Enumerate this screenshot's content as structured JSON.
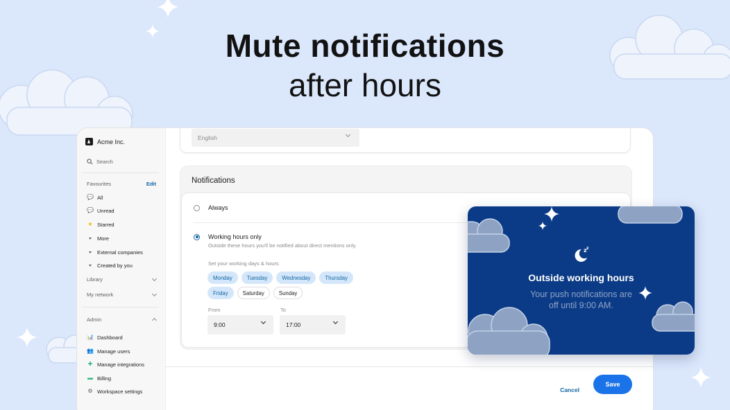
{
  "hero": {
    "line1": "Mute notifications",
    "line2": "after hours"
  },
  "sidebar": {
    "workspace": "Acme Inc.",
    "search": "Search",
    "favourites": {
      "label": "Favourites",
      "edit": "Edit"
    },
    "items": [
      {
        "label": "All",
        "icon": "speech-bubble-icon"
      },
      {
        "label": "Unread",
        "icon": "speech-bubble-icon"
      },
      {
        "label": "Starred",
        "icon": "star-icon"
      },
      {
        "label": "More",
        "icon": "caret-down-icon"
      },
      {
        "label": "External companies",
        "icon": "caret-down-icon"
      },
      {
        "label": "Created by you",
        "icon": "caret-down-icon"
      }
    ],
    "library": "Library",
    "my_network": "My network",
    "admin": "Admin",
    "admin_items": [
      {
        "label": "Dashboard",
        "icon": "bar-chart-icon"
      },
      {
        "label": "Manage users",
        "icon": "users-icon"
      },
      {
        "label": "Manage integrations",
        "icon": "puzzle-icon"
      },
      {
        "label": "Billing",
        "icon": "money-icon"
      },
      {
        "label": "Workspace settings",
        "icon": "gear-icon"
      }
    ]
  },
  "language": {
    "value": "English"
  },
  "notifications": {
    "title": "Notifications",
    "option_always": "Always",
    "option_working": "Working hours only",
    "working_hint": "Outside these hours you'll be notified about direct mentions only.",
    "days_label": "Set your working days & hours",
    "days": [
      {
        "label": "Monday",
        "selected": true
      },
      {
        "label": "Tuesday",
        "selected": true
      },
      {
        "label": "Wednesday",
        "selected": true
      },
      {
        "label": "Thursday",
        "selected": true
      },
      {
        "label": "Friday",
        "selected": true
      },
      {
        "label": "Saturday",
        "selected": false
      },
      {
        "label": "Sunday",
        "selected": false
      }
    ],
    "from_label": "From",
    "from_value": "9:00",
    "to_label": "To",
    "to_value": "17:00"
  },
  "footer": {
    "cancel": "Cancel",
    "save": "Save"
  },
  "popup": {
    "icon": "moon-sleep-icon",
    "title": "Outside working hours",
    "subtitle": "Your push notifications are\noff until 9:00 AM."
  },
  "colors": {
    "background": "#dbe7fb",
    "accent": "#1264a3",
    "save_button": "#1a73e8",
    "popup_bg": "#0b3b86",
    "day_selected_bg": "#d4e7fa"
  }
}
